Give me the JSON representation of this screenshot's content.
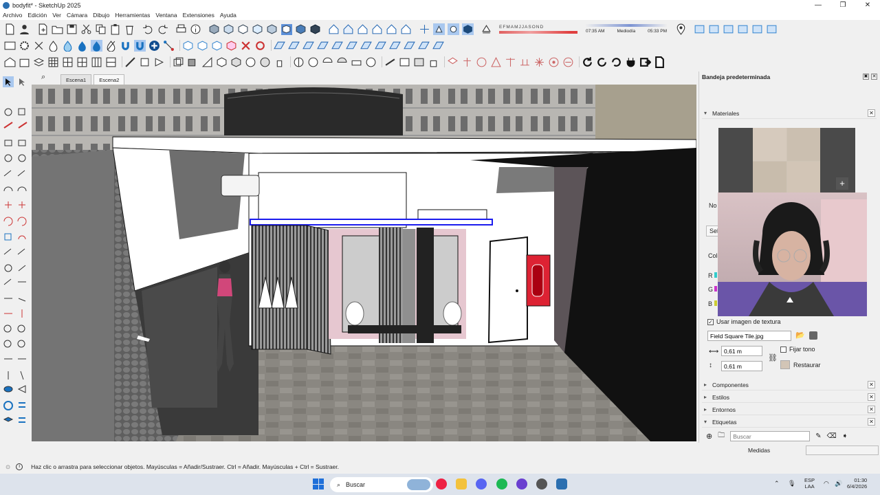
{
  "window": {
    "title": "bodyfit* - SketchUp 2025",
    "minimize": "—",
    "maximize": "❐",
    "close": "✕"
  },
  "menu": [
    "Archivo",
    "Edición",
    "Ver",
    "Cámara",
    "Dibujo",
    "Herramientas",
    "Ventana",
    "Extensiones",
    "Ayuda"
  ],
  "shadow": {
    "months": [
      "E",
      "F",
      "M",
      "A",
      "M",
      "J",
      "J",
      "A",
      "S",
      "O",
      "N",
      "D"
    ],
    "time_start": "07:35 AM",
    "midday": "Mediodía",
    "time_end": "05:33 PM"
  },
  "scenes": [
    "Escena1",
    "Escena2"
  ],
  "tray": {
    "title": "Bandeja predeterminada",
    "materials": {
      "header": "Materiales",
      "partial_name_label": "No",
      "partial_select_label": "Sel",
      "partial_color_label": "Colo",
      "rgb": [
        "R",
        "G",
        "B"
      ],
      "use_texture_label": "Usar imagen de textura",
      "texture_file": "Field Square Tile.jpg",
      "width": "0,61 m",
      "height": "0,61 m",
      "fix_tone_label": "Fijar tono",
      "restore_label": "Restaurar"
    },
    "panels": [
      "Componentes",
      "Estilos",
      "Entornos",
      "Etiquetas"
    ],
    "tags_search_placeholder": "Buscar"
  },
  "status": {
    "hint": "Haz clic o arrastra para seleccionar objetos. Mayúsculas = Añadir/Sustraer. Ctrl = Añadir. Mayúsculas + Ctrl = Sustraer.",
    "measures_label": "Medidas"
  },
  "taskbar": {
    "search_label": "Buscar",
    "lang": "ESP",
    "lang_sub": "LAA",
    "time": "01:30",
    "date": "6/4/2026"
  }
}
